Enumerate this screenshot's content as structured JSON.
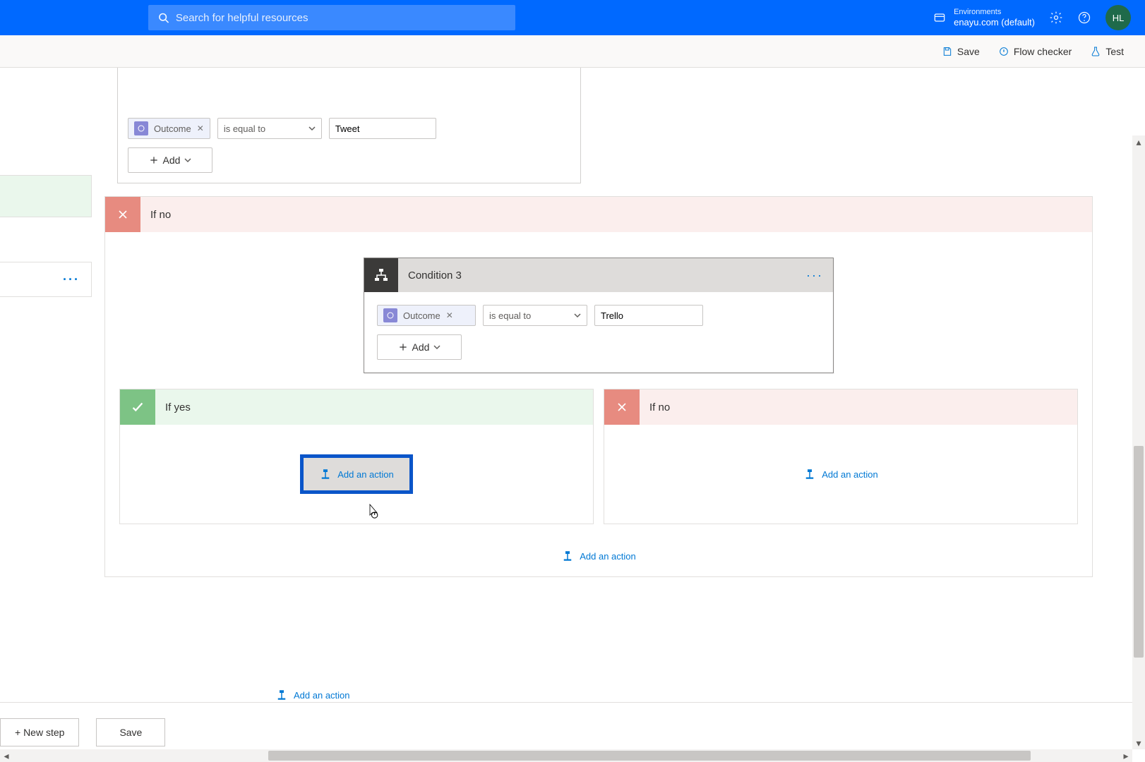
{
  "header": {
    "search_placeholder": "Search for helpful resources",
    "env_label": "Environments",
    "env_name": "enayu.com (default)",
    "avatar_initials": "HL"
  },
  "toolbar": {
    "save": "Save",
    "flow_checker": "Flow checker",
    "test": "Test"
  },
  "top_condition": {
    "chip_label": "Outcome",
    "operator": "is equal to",
    "value": "Tweet",
    "add_label": "Add"
  },
  "outer_ifno": {
    "title": "If no"
  },
  "condition3": {
    "title": "Condition 3",
    "chip_label": "Outcome",
    "operator": "is equal to",
    "value": "Trello",
    "add_label": "Add"
  },
  "branch_yes": {
    "title": "If yes",
    "add_action": "Add an action"
  },
  "branch_no": {
    "title": "If no",
    "add_action": "Add an action"
  },
  "lower_add_action_1": "Add an action",
  "lower_add_action_2": "Add an action",
  "bottom": {
    "new_step": "+ New step",
    "save": "Save"
  }
}
